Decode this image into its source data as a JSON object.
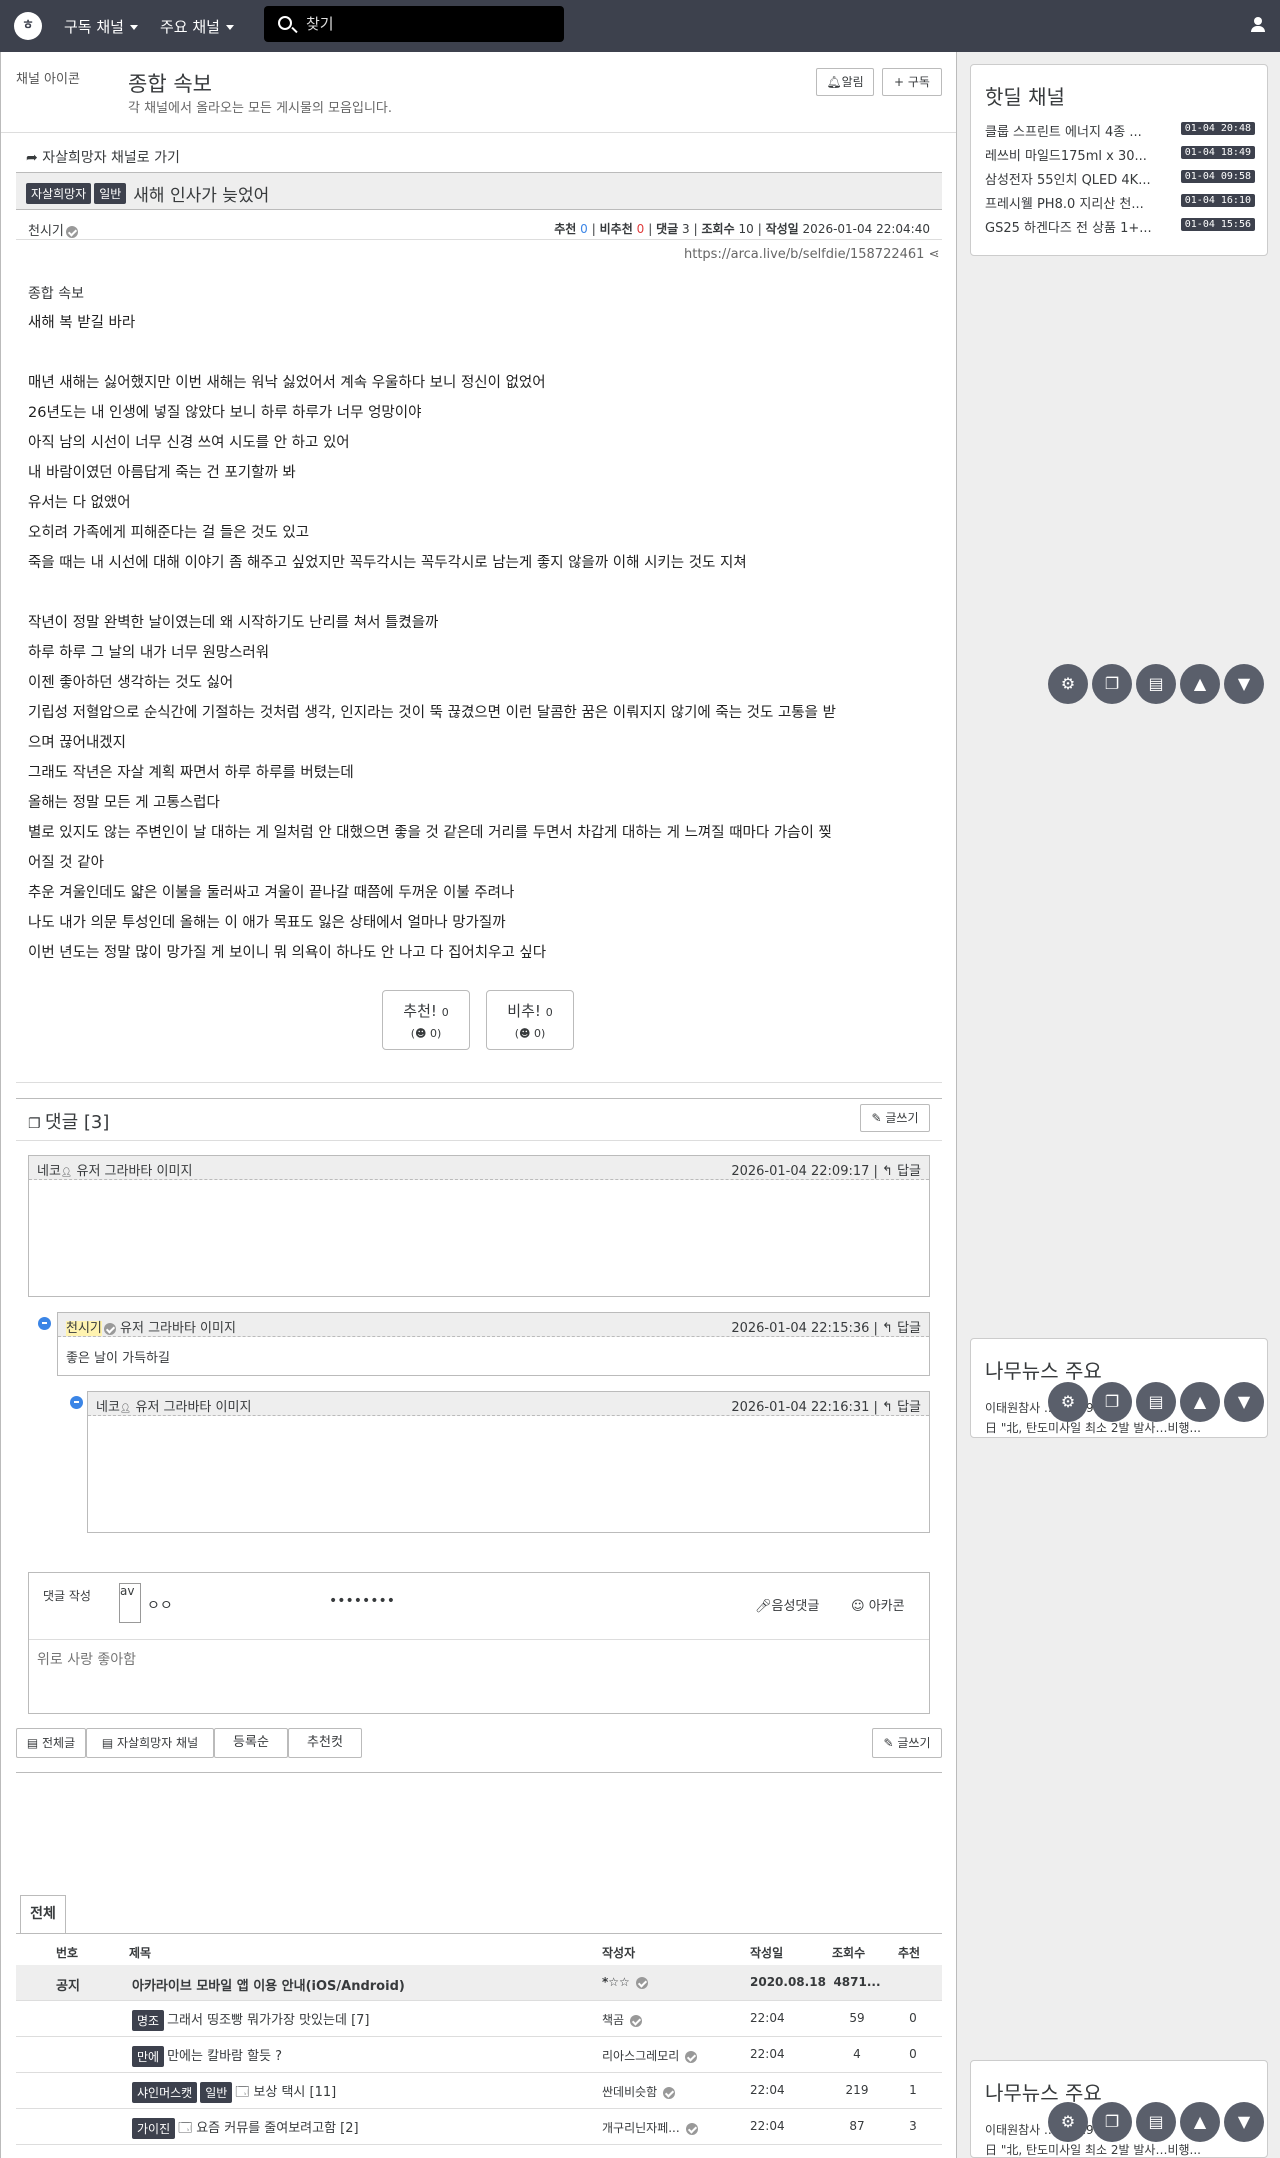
{
  "nav": {
    "logo_text": "ㅎ",
    "subscribed": "구독 채널",
    "main": "주요 채널",
    "search_placeholder": "찾기"
  },
  "board": {
    "icon_alt": "채널 아이콘",
    "title": "종합 속보",
    "desc": "각 채널에서 올라오는 모든 게시물의 모음입니다.",
    "alarm_btn": "알림",
    "subscribe_btn": "+ 구독"
  },
  "article": {
    "goto": "자살희망자 채널로 가기",
    "badge_channel": "자살희망자",
    "badge_cat": "일반",
    "title": "새해 인사가 늦었어",
    "author": "천시기",
    "up_label": "추천",
    "up": "0",
    "down_label": "비추천",
    "down": "0",
    "comment_label": "댓글",
    "comments": "3",
    "view_label": "조회수",
    "views": "10",
    "date_label": "작성일",
    "date": "2026-01-04 22:04:40",
    "url": "https://arca.live/b/selfdie/158722461",
    "img_alt": "종합 속보",
    "lines": [
      "새해 복 받길 바라",
      "",
      "매년 새해는 싫어했지만 이번 새해는 워낙 싫었어서 계속 우울하다 보니 정신이 없었어",
      "26년도는 내 인생에 넣질 않았다 보니 하루 하루가 너무 엉망이야",
      "아직 남의 시선이 너무 신경 쓰여 시도를 안 하고 있어",
      "내 바람이였던 아름답게 죽는 건 포기할까 봐",
      "유서는 다 없앴어",
      "오히려 가족에게 피해준다는 걸 들은 것도 있고",
      "죽을 때는 내 시선에 대해 이야기 좀 해주고 싶었지만 꼭두각시는 꼭두각시로 남는게 좋지 않을까 이해 시키는 것도 지쳐",
      "",
      "작년이 정말 완벽한 날이였는데 왜 시작하기도 난리를 쳐서 틀켰을까",
      "하루 하루 그 날의 내가 너무 원망스러워",
      "이젠 좋아하던 생각하는 것도 싫어",
      "기립성 저혈압으로 순식간에 기절하는 것처럼 생각, 인지라는 것이 뚝 끊겼으면 이런 달콤한 꿈은 이뤄지지 않기에 죽는 것도 고통을 받",
      "으며 끊어내겠지",
      "그래도 작년은 자살 계획 짜면서 하루 하루를 버텼는데",
      "올해는 정말 모든 게 고통스럽다",
      "별로 있지도 않는 주변인이 날 대하는 게 일처럼 안 대했으면 좋을 것 같은데 거리를 두면서 차갑게 대하는 게 느껴질 때마다 가슴이 찢",
      "어질 것 같아",
      "추운 겨울인데도 얇은 이불을 둘러싸고 겨울이 끝나갈 때쯤에 두꺼운 이불 주려나",
      "나도 내가 의문 투성인데 올해는 이 애가 목표도 잃은 상태에서 얼마나 망가질까",
      "이번 년도는 정말 많이 망가질 게 보이니 뭐 의욕이 하나도 안 나고 다 집어치우고 싶다"
    ],
    "vote_up": "추천!",
    "vote_up_count": "0",
    "vote_up_sub": "0",
    "vote_down": "비추!",
    "vote_down_count": "0",
    "vote_down_sub": "0"
  },
  "comments": {
    "header": "댓글 [3]",
    "write_btn": "글쓰기",
    "reply": "답글",
    "avatar_alt": "유저 그라바타 이미지",
    "items": [
      {
        "author": "네코",
        "time": "2026-01-04 22:09:17",
        "text": ""
      },
      {
        "author": "천시기",
        "time": "2026-01-04 22:15:36",
        "text": "좋은 날이 가득하길"
      },
      {
        "author": "네코",
        "time": "2026-01-04 22:16:31",
        "text": ""
      }
    ],
    "write_label": "댓글 작성",
    "write_avatar_alt": "av",
    "write_nick": "ㅇㅇ",
    "write_pw": "••••••••",
    "voice": "음성댓글",
    "arcacon": "아카콘",
    "placeholder": "위로 사랑 좋아함"
  },
  "board_nav": {
    "all": "전체글",
    "channel": "자살희망자 채널",
    "sort_reg": "등록순",
    "sort_best": "추천컷",
    "write": "글쓰기"
  },
  "sidebar": {
    "hotdeal_title": "핫딜 채널",
    "deals": [
      {
        "name": "클룹 스프린트 에너지 4종 ...",
        "time": "01-04 20:48"
      },
      {
        "name": "레쓰비 마일드175ml x 30...",
        "time": "01-04 18:49"
      },
      {
        "name": "삼성전자 55인치 QLED 4K...",
        "time": "01-04 09:58"
      },
      {
        "name": "프레시웰 PH8.0 지리산 천...",
        "time": "01-04 16:10"
      },
      {
        "name": "GS25 하겐다즈 전 상품 1+...",
        "time": "01-04 15:56"
      }
    ],
    "news_title": "나무뉴스 주요",
    "news": [
      "이태원참사 ... 12.29 참사",
      "日 \"北, 탄도미사일 최소 2발 발사…비행..."
    ]
  },
  "table": {
    "tab": "전체",
    "headers": {
      "no": "번호",
      "title": "제목",
      "author": "작성자",
      "date": "작성일",
      "views": "조회수",
      "up": "추천"
    },
    "rows": [
      {
        "no": "공지",
        "badges": [],
        "title": "아카라이브 모바일 앱 이용 안내(iOS/Android)",
        "author": "*☆☆",
        "date": "2020.08.18",
        "views": "4871...",
        "up": ""
      },
      {
        "no": "",
        "badges": [
          "명조"
        ],
        "title": "그래서 띵조빵 뭐가가장 맛있는데 [7]",
        "author": "책곰",
        "date": "22:04",
        "views": "59",
        "up": "0"
      },
      {
        "no": "",
        "badges": [
          "만에"
        ],
        "title": "만에는 칼바람 할듯 ?",
        "author": "리아스그레모리",
        "date": "22:04",
        "views": "4",
        "up": "0"
      },
      {
        "no": "",
        "badges": [
          "샤인머스캣",
          "일반"
        ],
        "title": "보상 택시 [11]",
        "author": "싼데비슷함",
        "date": "22:04",
        "views": "219",
        "up": "1"
      },
      {
        "no": "",
        "badges": [
          "가이진"
        ],
        "title": "요즘 커뮤를 줄여보려고함 [2]",
        "author": "개구리닌자페...",
        "date": "22:04",
        "views": "87",
        "up": "3"
      }
    ]
  }
}
